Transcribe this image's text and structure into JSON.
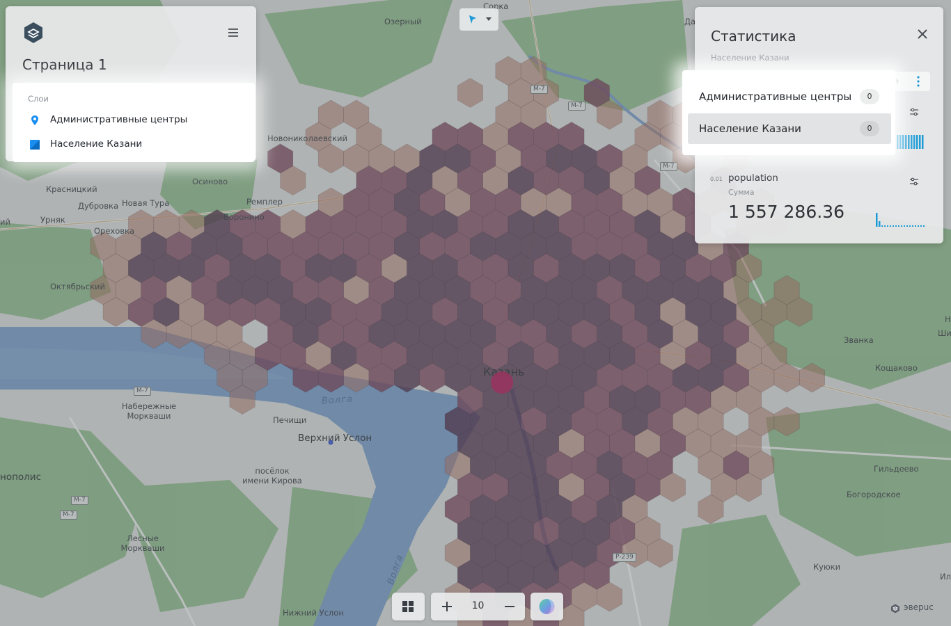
{
  "sidebar": {
    "page_title": "Страница 1",
    "layers_heading": "Слои",
    "layers": [
      {
        "name": "Административные центры",
        "icon": "map-pin-icon",
        "color": "#1a8ef0"
      },
      {
        "name": "Население Казани",
        "icon": "polygon-layer-icon",
        "color": "#1a8ef0"
      }
    ]
  },
  "stats": {
    "title": "Статистика",
    "subtitle": "Население Казани",
    "metric": {
      "icon_label": "0.01",
      "name": "population",
      "aggregation": "Сумма",
      "value": "1 557 286.36"
    }
  },
  "layer_popup": {
    "items": [
      {
        "name": "Административные центры",
        "count": "0",
        "active": false
      },
      {
        "name": "Население Казани",
        "count": "0",
        "active": true
      }
    ]
  },
  "controls": {
    "zoom_level": "10",
    "grid_icon": "grid-icon",
    "basemap_icon": "basemap-globe-icon"
  },
  "attribution": "эверuc",
  "map": {
    "river_labels": [
      "Волга",
      "Волга"
    ],
    "places": [
      "Озерный",
      "Да",
      "Новониколаевский",
      "Осиново",
      "Ремплер",
      "Красницкий",
      "Дубровка",
      "Новая Тура",
      "Урняк",
      "Ореховка",
      "Воронино",
      "ий",
      "Октябрьский",
      "Набережные Моркваши",
      "Печищи",
      "Верхний Услон",
      "посёлок имени Кирова",
      "нополис",
      "Лесные Моркваши",
      "Нижний Услон",
      "Казань",
      "Званка",
      "Кощаково",
      "Ши",
      "Н",
      "Гильдеево",
      "Богородское",
      "Куюки",
      "Ил",
      "Сорка"
    ],
    "road_shields": [
      "М-7",
      "М-7",
      "М-7",
      "М-7",
      "М-7",
      "М-7",
      "Р-239"
    ],
    "colors": {
      "water": "#7ea3cf",
      "forest": "#8fbf8a",
      "land": "#e6e8e4",
      "hex_dark": "#4a2440",
      "hex_mid": "#7a3a52",
      "hex_light": "#b8735d",
      "accent_blue": "#1a8ef0",
      "center_point": "#c2185b"
    }
  }
}
